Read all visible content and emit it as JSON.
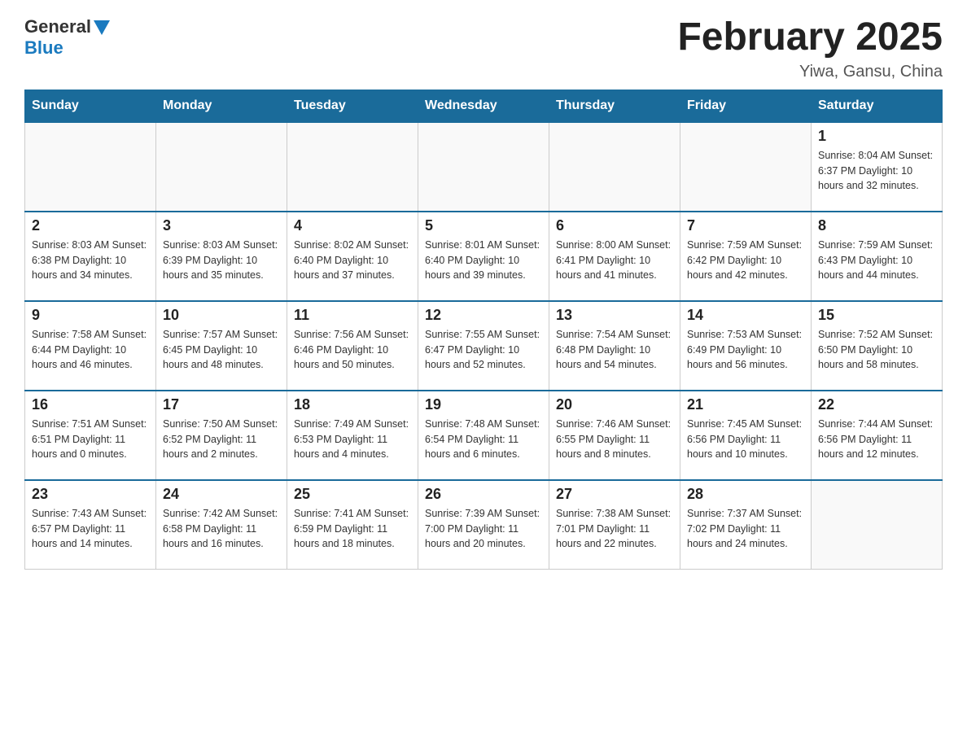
{
  "logo": {
    "general": "General",
    "blue": "Blue"
  },
  "header": {
    "title": "February 2025",
    "location": "Yiwa, Gansu, China"
  },
  "weekdays": [
    "Sunday",
    "Monday",
    "Tuesday",
    "Wednesday",
    "Thursday",
    "Friday",
    "Saturday"
  ],
  "weeks": [
    [
      {
        "day": "",
        "info": ""
      },
      {
        "day": "",
        "info": ""
      },
      {
        "day": "",
        "info": ""
      },
      {
        "day": "",
        "info": ""
      },
      {
        "day": "",
        "info": ""
      },
      {
        "day": "",
        "info": ""
      },
      {
        "day": "1",
        "info": "Sunrise: 8:04 AM\nSunset: 6:37 PM\nDaylight: 10 hours and 32 minutes."
      }
    ],
    [
      {
        "day": "2",
        "info": "Sunrise: 8:03 AM\nSunset: 6:38 PM\nDaylight: 10 hours and 34 minutes."
      },
      {
        "day": "3",
        "info": "Sunrise: 8:03 AM\nSunset: 6:39 PM\nDaylight: 10 hours and 35 minutes."
      },
      {
        "day": "4",
        "info": "Sunrise: 8:02 AM\nSunset: 6:40 PM\nDaylight: 10 hours and 37 minutes."
      },
      {
        "day": "5",
        "info": "Sunrise: 8:01 AM\nSunset: 6:40 PM\nDaylight: 10 hours and 39 minutes."
      },
      {
        "day": "6",
        "info": "Sunrise: 8:00 AM\nSunset: 6:41 PM\nDaylight: 10 hours and 41 minutes."
      },
      {
        "day": "7",
        "info": "Sunrise: 7:59 AM\nSunset: 6:42 PM\nDaylight: 10 hours and 42 minutes."
      },
      {
        "day": "8",
        "info": "Sunrise: 7:59 AM\nSunset: 6:43 PM\nDaylight: 10 hours and 44 minutes."
      }
    ],
    [
      {
        "day": "9",
        "info": "Sunrise: 7:58 AM\nSunset: 6:44 PM\nDaylight: 10 hours and 46 minutes."
      },
      {
        "day": "10",
        "info": "Sunrise: 7:57 AM\nSunset: 6:45 PM\nDaylight: 10 hours and 48 minutes."
      },
      {
        "day": "11",
        "info": "Sunrise: 7:56 AM\nSunset: 6:46 PM\nDaylight: 10 hours and 50 minutes."
      },
      {
        "day": "12",
        "info": "Sunrise: 7:55 AM\nSunset: 6:47 PM\nDaylight: 10 hours and 52 minutes."
      },
      {
        "day": "13",
        "info": "Sunrise: 7:54 AM\nSunset: 6:48 PM\nDaylight: 10 hours and 54 minutes."
      },
      {
        "day": "14",
        "info": "Sunrise: 7:53 AM\nSunset: 6:49 PM\nDaylight: 10 hours and 56 minutes."
      },
      {
        "day": "15",
        "info": "Sunrise: 7:52 AM\nSunset: 6:50 PM\nDaylight: 10 hours and 58 minutes."
      }
    ],
    [
      {
        "day": "16",
        "info": "Sunrise: 7:51 AM\nSunset: 6:51 PM\nDaylight: 11 hours and 0 minutes."
      },
      {
        "day": "17",
        "info": "Sunrise: 7:50 AM\nSunset: 6:52 PM\nDaylight: 11 hours and 2 minutes."
      },
      {
        "day": "18",
        "info": "Sunrise: 7:49 AM\nSunset: 6:53 PM\nDaylight: 11 hours and 4 minutes."
      },
      {
        "day": "19",
        "info": "Sunrise: 7:48 AM\nSunset: 6:54 PM\nDaylight: 11 hours and 6 minutes."
      },
      {
        "day": "20",
        "info": "Sunrise: 7:46 AM\nSunset: 6:55 PM\nDaylight: 11 hours and 8 minutes."
      },
      {
        "day": "21",
        "info": "Sunrise: 7:45 AM\nSunset: 6:56 PM\nDaylight: 11 hours and 10 minutes."
      },
      {
        "day": "22",
        "info": "Sunrise: 7:44 AM\nSunset: 6:56 PM\nDaylight: 11 hours and 12 minutes."
      }
    ],
    [
      {
        "day": "23",
        "info": "Sunrise: 7:43 AM\nSunset: 6:57 PM\nDaylight: 11 hours and 14 minutes."
      },
      {
        "day": "24",
        "info": "Sunrise: 7:42 AM\nSunset: 6:58 PM\nDaylight: 11 hours and 16 minutes."
      },
      {
        "day": "25",
        "info": "Sunrise: 7:41 AM\nSunset: 6:59 PM\nDaylight: 11 hours and 18 minutes."
      },
      {
        "day": "26",
        "info": "Sunrise: 7:39 AM\nSunset: 7:00 PM\nDaylight: 11 hours and 20 minutes."
      },
      {
        "day": "27",
        "info": "Sunrise: 7:38 AM\nSunset: 7:01 PM\nDaylight: 11 hours and 22 minutes."
      },
      {
        "day": "28",
        "info": "Sunrise: 7:37 AM\nSunset: 7:02 PM\nDaylight: 11 hours and 24 minutes."
      },
      {
        "day": "",
        "info": ""
      }
    ]
  ]
}
